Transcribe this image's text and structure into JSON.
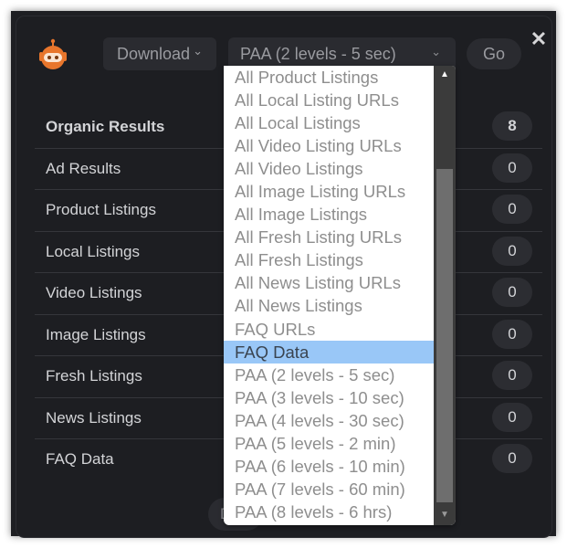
{
  "header": {
    "download_label": "Download",
    "download_chevron": "⌄",
    "mode_select_value": "PAA (2 levels - 5 sec)",
    "mode_select_chevron": "⌄",
    "go_label": "Go",
    "close_glyph": "✕",
    "brand_color": "#e8762c"
  },
  "results": [
    {
      "label": "Organic Results",
      "count": "8",
      "bold": true
    },
    {
      "label": "Ad Results",
      "count": "0"
    },
    {
      "label": "Product Listings",
      "count": "0"
    },
    {
      "label": "Local Listings",
      "count": "0"
    },
    {
      "label": "Video Listings",
      "count": "0"
    },
    {
      "label": "Image Listings",
      "count": "0"
    },
    {
      "label": "Fresh Listings",
      "count": "0"
    },
    {
      "label": "News Listings",
      "count": "0"
    },
    {
      "label": "FAQ Data",
      "count": "0"
    }
  ],
  "hidden_button_partial_label": "D",
  "dropdown": {
    "highlighted": "FAQ Data",
    "options": [
      "All Product Listings",
      "All Local Listing URLs",
      "All Local Listings",
      "All Video Listing URLs",
      "All Video Listings",
      "All Image Listing URLs",
      "All Image Listings",
      "All Fresh Listing URLs",
      "All Fresh Listings",
      "All News Listing URLs",
      "All News Listings",
      "FAQ URLs",
      "FAQ Data",
      "PAA (2 levels - 5 sec)",
      "PAA (3 levels - 10 sec)",
      "PAA (4 levels - 30 sec)",
      "PAA (5 levels - 2 min)",
      "PAA (6 levels - 10 min)",
      "PAA (7 levels - 60 min)",
      "PAA (8 levels - 6 hrs)"
    ],
    "scroll_up_glyph": "▲",
    "scroll_down_glyph": "▼"
  }
}
